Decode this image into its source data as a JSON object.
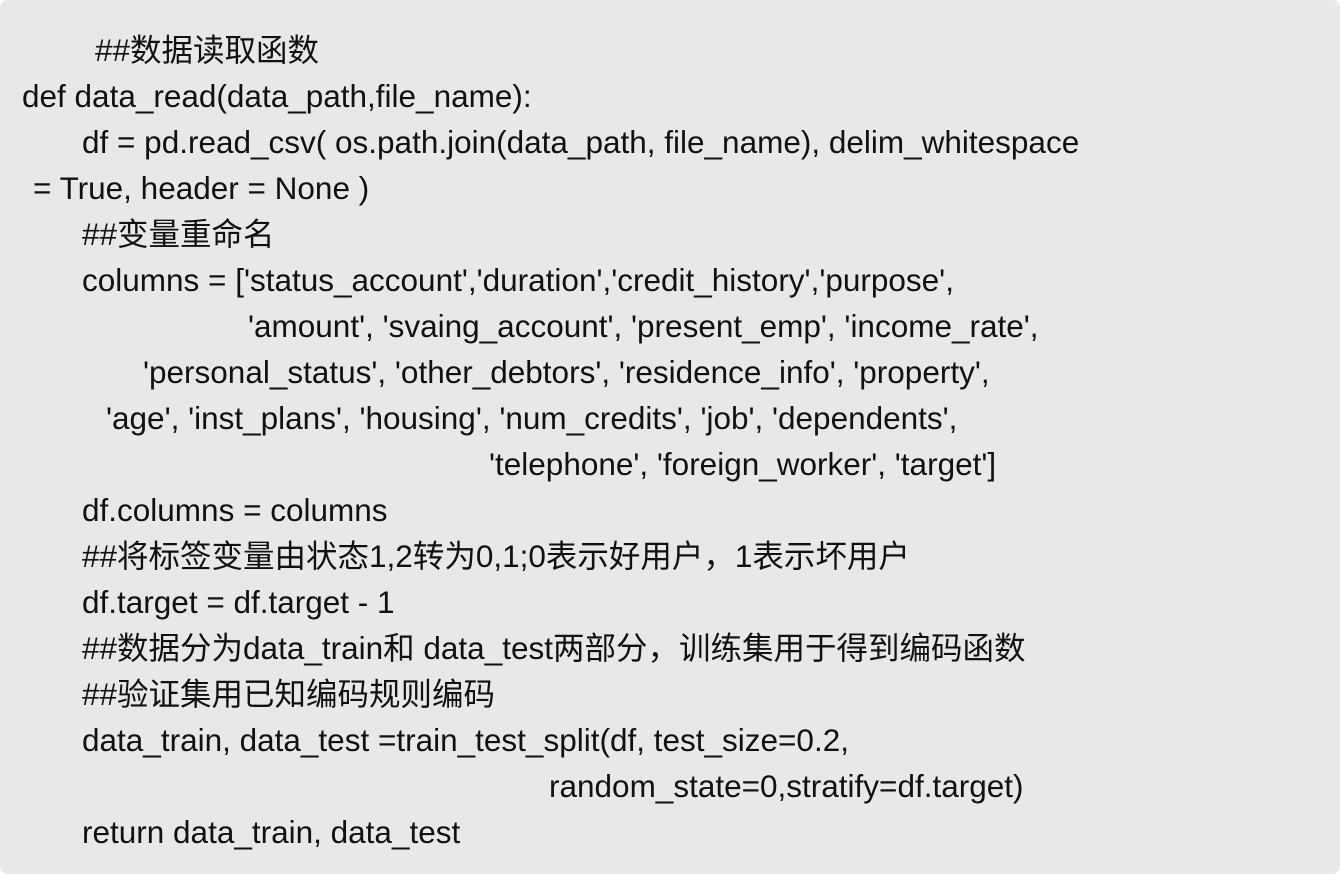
{
  "code": {
    "lines": [
      "##数据读取函数",
      "def data_read(data_path,file_name):",
      "df = pd.read_csv( os.path.join(data_path, file_name), delim_whitespace",
      "= True, header = None )",
      "##变量重命名",
      "columns = ['status_account','duration','credit_history','purpose',",
      "'amount', 'svaing_account', 'present_emp', 'income_rate',",
      "'personal_status', 'other_debtors', 'residence_info', 'property',",
      "'age', 'inst_plans', 'housing', 'num_credits', 'job', 'dependents',",
      "'telephone', 'foreign_worker', 'target']",
      "df.columns = columns",
      "##将标签变量由状态1,2转为0,1;0表示好用户，1表示坏用户",
      "df.target = df.target - 1",
      "##数据分为data_train和 data_test两部分，训练集用于得到编码函数",
      "##验证集用已知编码规则编码",
      "data_train, data_test =train_test_split(df, test_size=0.2,",
      "random_state=0,stratify=df.target)",
      "return data_train, data_test"
    ]
  }
}
